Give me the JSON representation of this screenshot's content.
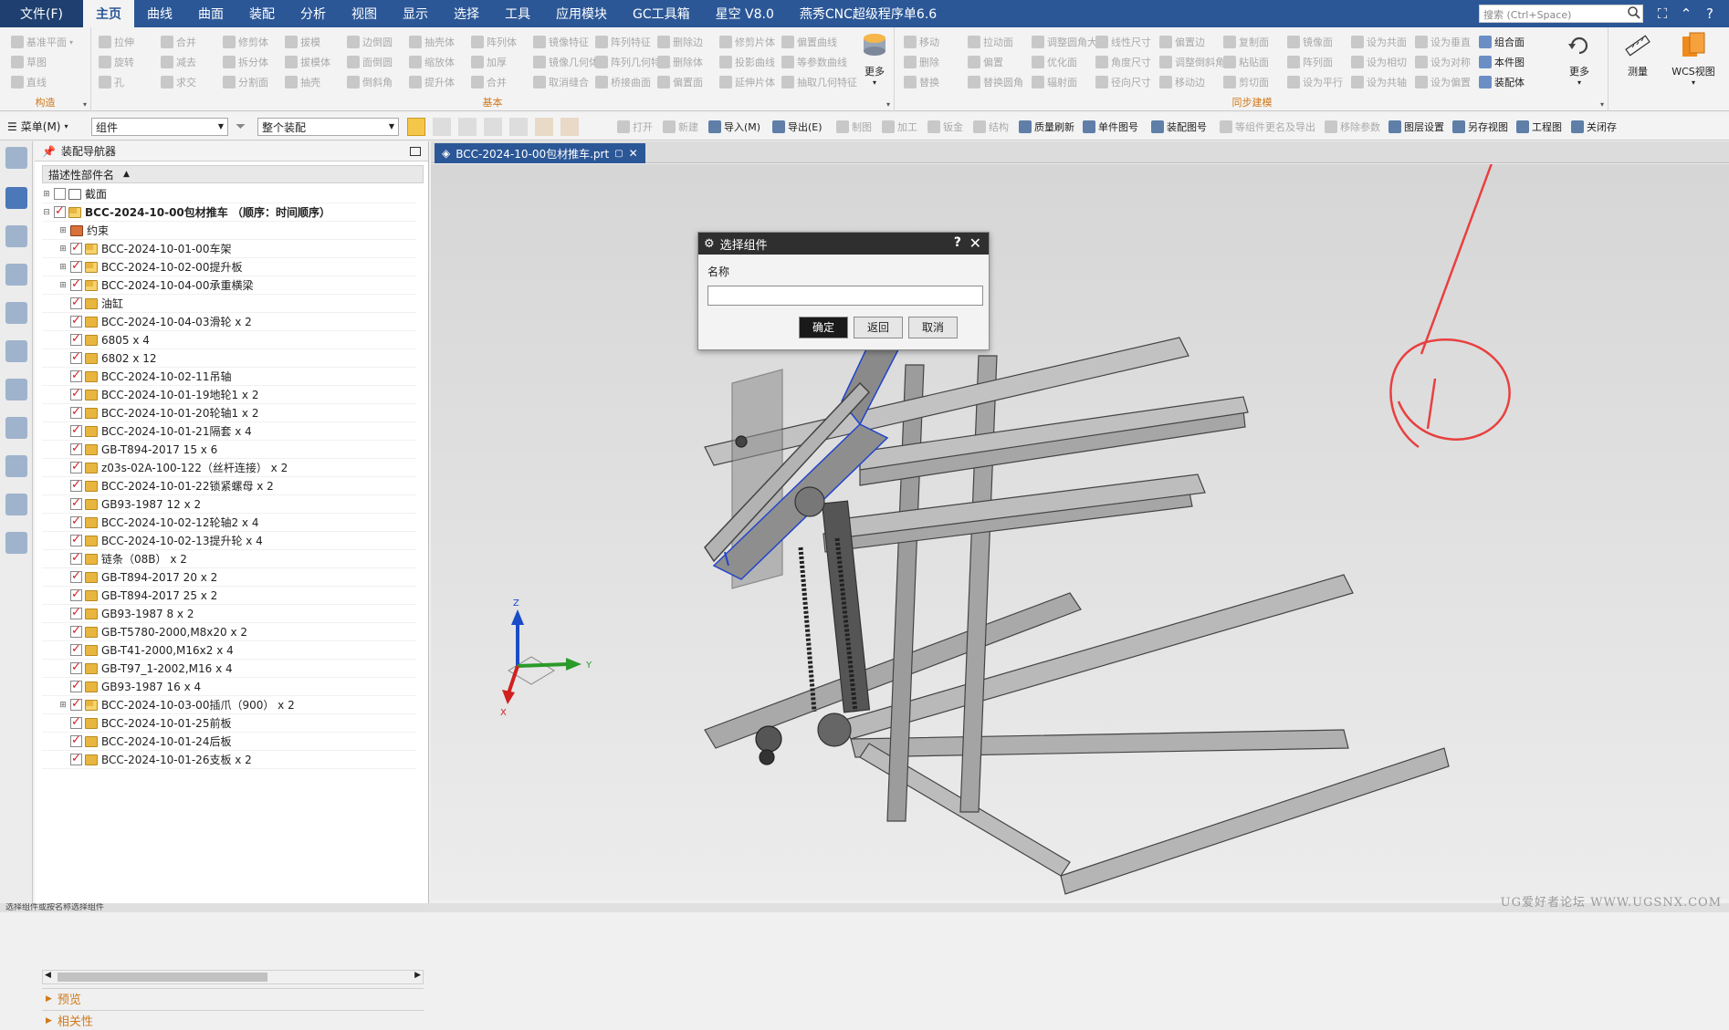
{
  "menubar": {
    "tabs": [
      {
        "label": "文件(F)"
      },
      {
        "label": "主页"
      },
      {
        "label": "曲线"
      },
      {
        "label": "曲面"
      },
      {
        "label": "装配"
      },
      {
        "label": "分析"
      },
      {
        "label": "视图"
      },
      {
        "label": "显示"
      },
      {
        "label": "选择"
      },
      {
        "label": "工具"
      },
      {
        "label": "应用模块"
      },
      {
        "label": "GC工具箱"
      },
      {
        "label": "星空 V8.0"
      },
      {
        "label": "燕秀CNC超级程序单6.6"
      }
    ],
    "active_tab": "主页",
    "search_placeholder": "搜索 (Ctrl+Space)"
  },
  "ribbon": {
    "construct": {
      "label": "构造",
      "items": [
        "基准平面",
        "草图",
        "直线"
      ]
    },
    "basic": {
      "label": "基本",
      "items": [
        "拉伸",
        "合并",
        "修剪体",
        "拔模",
        "边倒圆",
        "抽壳体",
        "阵列体",
        "镜像特征",
        "阵列特征",
        "删除边",
        "修剪片体",
        "偏置曲线",
        "旋转",
        "减去",
        "拆分体",
        "拔模体",
        "面倒圆",
        "缩放体",
        "加厚",
        "镜像几何体",
        "阵列几何特征",
        "删除体",
        "投影曲线",
        "等参数曲线",
        "孔",
        "求交",
        "分割面",
        "抽壳",
        "倒斜角",
        "提升体",
        "合并",
        "取消缝合",
        "桥接曲面",
        "偏置面",
        "延伸片体",
        "抽取几何特征"
      ],
      "more_label": "更多"
    },
    "sync": {
      "label": "同步建模",
      "items": [
        "移动",
        "拉动面",
        "调整圆角大小",
        "线性尺寸",
        "偏置边",
        "复制面",
        "镜像面",
        "设为共面",
        "设为垂直",
        "组合面",
        "删除",
        "偏置",
        "优化面",
        "角度尺寸",
        "调整倒斜角",
        "粘贴面",
        "阵列面",
        "设为相切",
        "设为对称",
        "本件图",
        "替换",
        "替换圆角",
        "辐射面",
        "径向尺寸",
        "移动边",
        "剪切面",
        "设为平行",
        "设为共轴",
        "设为偏置",
        "装配体"
      ],
      "more_label": "更多"
    },
    "measure_label": "测量",
    "wcs_label": "WCS视图"
  },
  "toolbar2": {
    "menu_label": "菜单(M)",
    "filter_value": "组件",
    "scope_value": "整个装配",
    "items": [
      {
        "label": "打开",
        "enabled": false
      },
      {
        "label": "新建",
        "enabled": false
      },
      {
        "label": "导入(M)",
        "enabled": true
      },
      {
        "label": "导出(E)",
        "enabled": true
      },
      {
        "label": "制图",
        "enabled": false
      },
      {
        "label": "加工",
        "enabled": false
      },
      {
        "label": "钣金",
        "enabled": false
      },
      {
        "label": "结构",
        "enabled": false
      },
      {
        "label": "质量刷新",
        "enabled": true
      },
      {
        "label": "单件图号",
        "enabled": true
      },
      {
        "label": "装配图号",
        "enabled": true
      },
      {
        "label": "等组件更名及导出",
        "enabled": false
      },
      {
        "label": "移除参数",
        "enabled": false
      },
      {
        "label": "图层设置",
        "enabled": true
      },
      {
        "label": "另存视图",
        "enabled": true
      },
      {
        "label": "工程图",
        "enabled": true
      },
      {
        "label": "关闭存",
        "enabled": true
      }
    ]
  },
  "navigator": {
    "title": "装配导航器",
    "column_header": "描述性部件名",
    "rows": [
      {
        "label": "截面",
        "indent": 0,
        "exp": "+",
        "checked": false,
        "icon": "folder",
        "bold": false
      },
      {
        "label": "BCC-2024-10-00包材推车 （顺序：时间顺序）",
        "indent": 0,
        "exp": "-",
        "checked": true,
        "icon": "asm",
        "bold": true
      },
      {
        "label": "约束",
        "indent": 1,
        "exp": "+",
        "checked": null,
        "icon": "constraint",
        "bold": false
      },
      {
        "label": "BCC-2024-10-01-00车架",
        "indent": 1,
        "exp": "+",
        "checked": true,
        "icon": "asm",
        "bold": false
      },
      {
        "label": "BCC-2024-10-02-00提升板",
        "indent": 1,
        "exp": "+",
        "checked": true,
        "icon": "asm",
        "bold": false
      },
      {
        "label": "BCC-2024-10-04-00承重横梁",
        "indent": 1,
        "exp": "+",
        "checked": true,
        "icon": "asm",
        "bold": false
      },
      {
        "label": "油缸",
        "indent": 1,
        "exp": "",
        "checked": true,
        "icon": "part",
        "bold": false
      },
      {
        "label": "BCC-2024-10-04-03滑轮 x 2",
        "indent": 1,
        "exp": "",
        "checked": true,
        "icon": "part",
        "bold": false
      },
      {
        "label": "6805 x 4",
        "indent": 1,
        "exp": "",
        "checked": true,
        "icon": "part",
        "bold": false
      },
      {
        "label": "6802 x 12",
        "indent": 1,
        "exp": "",
        "checked": true,
        "icon": "part",
        "bold": false
      },
      {
        "label": "BCC-2024-10-02-11吊轴",
        "indent": 1,
        "exp": "",
        "checked": true,
        "icon": "part",
        "bold": false
      },
      {
        "label": "BCC-2024-10-01-19地轮1 x 2",
        "indent": 1,
        "exp": "",
        "checked": true,
        "icon": "part",
        "bold": false
      },
      {
        "label": "BCC-2024-10-01-20轮轴1 x 2",
        "indent": 1,
        "exp": "",
        "checked": true,
        "icon": "part",
        "bold": false
      },
      {
        "label": "BCC-2024-10-01-21隔套 x 4",
        "indent": 1,
        "exp": "",
        "checked": true,
        "icon": "part",
        "bold": false
      },
      {
        "label": "GB-T894-2017 15 x 6",
        "indent": 1,
        "exp": "",
        "checked": true,
        "icon": "part",
        "bold": false
      },
      {
        "label": "z03s-02A-100-122（丝杆连接） x 2",
        "indent": 1,
        "exp": "",
        "checked": true,
        "icon": "part",
        "bold": false
      },
      {
        "label": "BCC-2024-10-01-22锁紧螺母 x 2",
        "indent": 1,
        "exp": "",
        "checked": true,
        "icon": "part",
        "bold": false
      },
      {
        "label": "GB93-1987 12 x 2",
        "indent": 1,
        "exp": "",
        "checked": true,
        "icon": "part",
        "bold": false
      },
      {
        "label": "BCC-2024-10-02-12轮轴2 x 4",
        "indent": 1,
        "exp": "",
        "checked": true,
        "icon": "part",
        "bold": false
      },
      {
        "label": "BCC-2024-10-02-13提升轮 x 4",
        "indent": 1,
        "exp": "",
        "checked": true,
        "icon": "part",
        "bold": false
      },
      {
        "label": "链条（08B） x 2",
        "indent": 1,
        "exp": "",
        "checked": true,
        "icon": "part",
        "bold": false
      },
      {
        "label": "GB-T894-2017 20 x 2",
        "indent": 1,
        "exp": "",
        "checked": true,
        "icon": "part",
        "bold": false
      },
      {
        "label": "GB-T894-2017 25 x 2",
        "indent": 1,
        "exp": "",
        "checked": true,
        "icon": "part",
        "bold": false
      },
      {
        "label": "GB93-1987 8 x 2",
        "indent": 1,
        "exp": "",
        "checked": true,
        "icon": "part",
        "bold": false
      },
      {
        "label": "GB-T5780-2000,M8x20 x 2",
        "indent": 1,
        "exp": "",
        "checked": true,
        "icon": "part",
        "bold": false
      },
      {
        "label": "GB-T41-2000,M16x2 x 4",
        "indent": 1,
        "exp": "",
        "checked": true,
        "icon": "part",
        "bold": false
      },
      {
        "label": "GB-T97_1-2002,M16 x 4",
        "indent": 1,
        "exp": "",
        "checked": true,
        "icon": "part",
        "bold": false
      },
      {
        "label": "GB93-1987 16 x 4",
        "indent": 1,
        "exp": "",
        "checked": true,
        "icon": "part",
        "bold": false
      },
      {
        "label": "BCC-2024-10-03-00插爪（900） x 2",
        "indent": 1,
        "exp": "+",
        "checked": true,
        "icon": "asm",
        "bold": false
      },
      {
        "label": "BCC-2024-10-01-25前板",
        "indent": 1,
        "exp": "",
        "checked": true,
        "icon": "part",
        "bold": false
      },
      {
        "label": "BCC-2024-10-01-24后板",
        "indent": 1,
        "exp": "",
        "checked": true,
        "icon": "part",
        "bold": false
      },
      {
        "label": "BCC-2024-10-01-26支板 x 2",
        "indent": 1,
        "exp": "",
        "checked": true,
        "icon": "part",
        "bold": false
      }
    ],
    "section_preview": "预览",
    "section_relevance": "相关性"
  },
  "document": {
    "tab_label": "BCC-2024-10-00包材推车.prt"
  },
  "dialog": {
    "title": "选择组件",
    "help": "?",
    "name_label": "名称",
    "name_value": "",
    "ok_label": "确定",
    "back_label": "返回",
    "cancel_label": "取消"
  },
  "triad": {
    "x": "X",
    "y": "Y",
    "z": "Z"
  },
  "status": {
    "text": "选择组件或按名称选择组件",
    "watermark": "UG爱好者论坛 WWW.UGSNX.COM"
  },
  "colors": {
    "menubar": "#2b5797",
    "accent_orange": "#d07a1a",
    "annotation_red": "#e8403f",
    "edge_blue": "#2244cc"
  }
}
